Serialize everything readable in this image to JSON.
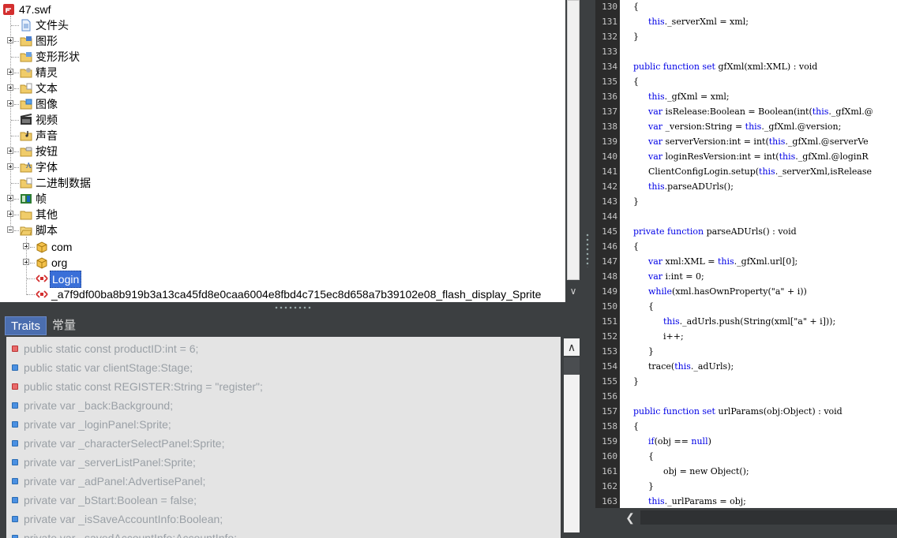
{
  "tree": {
    "root": "47.swf",
    "items": [
      {
        "label": "文件头"
      },
      {
        "label": "图形"
      },
      {
        "label": "变形形状"
      },
      {
        "label": "精灵"
      },
      {
        "label": "文本"
      },
      {
        "label": "图像"
      },
      {
        "label": "视频"
      },
      {
        "label": "声音"
      },
      {
        "label": "按钮"
      },
      {
        "label": "字体"
      },
      {
        "label": "二进制数据"
      },
      {
        "label": "帧"
      },
      {
        "label": "其他"
      },
      {
        "label": "脚本"
      }
    ],
    "scripts": [
      {
        "label": "com"
      },
      {
        "label": "org"
      },
      {
        "label": "Login"
      },
      {
        "label": "_a7f9df00ba8b919b3a13ca45fd8e0caa6004e8fbd4c715ec8d658a7b39102e08_flash_display_Sprite"
      }
    ]
  },
  "tabs": [
    {
      "label": "Traits"
    },
    {
      "label": "常量"
    }
  ],
  "traits": [
    {
      "text": "public static const productID:int = 6;",
      "color": "red"
    },
    {
      "text": "public static var clientStage:Stage;",
      "color": "blue"
    },
    {
      "text": "public static const REGISTER:String = \"register\";",
      "color": "red"
    },
    {
      "text": "private var _back:Background;",
      "color": "blue"
    },
    {
      "text": "private var _loginPanel:Sprite;",
      "color": "blue"
    },
    {
      "text": "private var _characterSelectPanel:Sprite;",
      "color": "blue"
    },
    {
      "text": "private var _serverListPanel:Sprite;",
      "color": "blue"
    },
    {
      "text": "private var _adPanel:AdvertisePanel;",
      "color": "blue"
    },
    {
      "text": "private var _bStart:Boolean = false;",
      "color": "blue"
    },
    {
      "text": "private var _isSaveAccountInfo:Boolean;",
      "color": "blue"
    },
    {
      "text": "private var _savedAccountInfo:AccountInfo;",
      "color": "blue"
    }
  ],
  "code": {
    "lines": [
      {
        "n": "130",
        "indent": 2,
        "parts": [
          {
            "t": "{"
          }
        ]
      },
      {
        "n": "131",
        "indent": 3,
        "parts": [
          {
            "t": "this",
            "k": true
          },
          {
            "t": "._serverXml = xml;"
          }
        ]
      },
      {
        "n": "132",
        "indent": 2,
        "parts": [
          {
            "t": "}"
          }
        ]
      },
      {
        "n": "133",
        "indent": 0,
        "parts": []
      },
      {
        "n": "134",
        "indent": 2,
        "parts": [
          {
            "t": "public function set",
            "k": true
          },
          {
            "t": " gfXml(xml:XML) : void"
          }
        ]
      },
      {
        "n": "135",
        "indent": 2,
        "parts": [
          {
            "t": "{"
          }
        ]
      },
      {
        "n": "136",
        "indent": 3,
        "parts": [
          {
            "t": "this",
            "k": true
          },
          {
            "t": "._gfXml = xml;"
          }
        ]
      },
      {
        "n": "137",
        "indent": 3,
        "parts": [
          {
            "t": "var",
            "k": true
          },
          {
            "t": " isRelease:Boolean = Boolean(int("
          },
          {
            "t": "this",
            "k": true
          },
          {
            "t": "._gfXml.@"
          }
        ]
      },
      {
        "n": "138",
        "indent": 3,
        "parts": [
          {
            "t": "var",
            "k": true
          },
          {
            "t": " _version:String = "
          },
          {
            "t": "this",
            "k": true
          },
          {
            "t": "._gfXml.@version;"
          }
        ]
      },
      {
        "n": "139",
        "indent": 3,
        "parts": [
          {
            "t": "var",
            "k": true
          },
          {
            "t": " serverVersion:int = int("
          },
          {
            "t": "this",
            "k": true
          },
          {
            "t": "._gfXml.@serverVe"
          }
        ]
      },
      {
        "n": "140",
        "indent": 3,
        "parts": [
          {
            "t": "var",
            "k": true
          },
          {
            "t": " loginResVersion:int = int("
          },
          {
            "t": "this",
            "k": true
          },
          {
            "t": "._gfXml.@loginR"
          }
        ]
      },
      {
        "n": "141",
        "indent": 3,
        "parts": [
          {
            "t": "ClientConfigLogin.setup("
          },
          {
            "t": "this",
            "k": true
          },
          {
            "t": "._serverXml,isRelease"
          }
        ]
      },
      {
        "n": "142",
        "indent": 3,
        "parts": [
          {
            "t": "this",
            "k": true
          },
          {
            "t": ".parseADUrls();"
          }
        ]
      },
      {
        "n": "143",
        "indent": 2,
        "parts": [
          {
            "t": "}"
          }
        ]
      },
      {
        "n": "144",
        "indent": 0,
        "parts": []
      },
      {
        "n": "145",
        "indent": 2,
        "parts": [
          {
            "t": "private function",
            "k": true
          },
          {
            "t": " parseADUrls() : void"
          }
        ]
      },
      {
        "n": "146",
        "indent": 2,
        "parts": [
          {
            "t": "{"
          }
        ]
      },
      {
        "n": "147",
        "indent": 3,
        "parts": [
          {
            "t": "var",
            "k": true
          },
          {
            "t": " xml:XML = "
          },
          {
            "t": "this",
            "k": true
          },
          {
            "t": "._gfXml.url[0];"
          }
        ]
      },
      {
        "n": "148",
        "indent": 3,
        "parts": [
          {
            "t": "var",
            "k": true
          },
          {
            "t": " i:int = 0;"
          }
        ]
      },
      {
        "n": "149",
        "indent": 3,
        "parts": [
          {
            "t": "while",
            "k": true
          },
          {
            "t": "(xml.hasOwnProperty(\"a\" + i))"
          }
        ]
      },
      {
        "n": "150",
        "indent": 3,
        "parts": [
          {
            "t": "{"
          }
        ]
      },
      {
        "n": "151",
        "indent": 4,
        "parts": [
          {
            "t": "this",
            "k": true
          },
          {
            "t": "._adUrls.push(String(xml[\"a\" + i]));"
          }
        ]
      },
      {
        "n": "152",
        "indent": 4,
        "parts": [
          {
            "t": "i++;"
          }
        ]
      },
      {
        "n": "153",
        "indent": 3,
        "parts": [
          {
            "t": "}"
          }
        ]
      },
      {
        "n": "154",
        "indent": 3,
        "parts": [
          {
            "t": "trace("
          },
          {
            "t": "this",
            "k": true
          },
          {
            "t": "._adUrls);"
          }
        ]
      },
      {
        "n": "155",
        "indent": 2,
        "parts": [
          {
            "t": "}"
          }
        ]
      },
      {
        "n": "156",
        "indent": 0,
        "parts": []
      },
      {
        "n": "157",
        "indent": 2,
        "parts": [
          {
            "t": "public function set",
            "k": true
          },
          {
            "t": " urlParams(obj:Object) : void"
          }
        ]
      },
      {
        "n": "158",
        "indent": 2,
        "parts": [
          {
            "t": "{"
          }
        ]
      },
      {
        "n": "159",
        "indent": 3,
        "parts": [
          {
            "t": "if",
            "k": true
          },
          {
            "t": "(obj == "
          },
          {
            "t": "null",
            "k": true
          },
          {
            "t": ")"
          }
        ]
      },
      {
        "n": "160",
        "indent": 3,
        "parts": [
          {
            "t": "{"
          }
        ]
      },
      {
        "n": "161",
        "indent": 4,
        "parts": [
          {
            "t": "obj = new Object();"
          }
        ]
      },
      {
        "n": "162",
        "indent": 3,
        "parts": [
          {
            "t": "}"
          }
        ]
      },
      {
        "n": "163",
        "indent": 3,
        "parts": [
          {
            "t": "this",
            "k": true
          },
          {
            "t": "._urlParams = obj;"
          }
        ]
      }
    ]
  },
  "colors": {
    "keyword": "#0000e6",
    "selection": "#3a6fd8",
    "panel_bg": "#3c3f41",
    "trait_red": "#e86a6a",
    "trait_blue": "#4a90e2"
  }
}
